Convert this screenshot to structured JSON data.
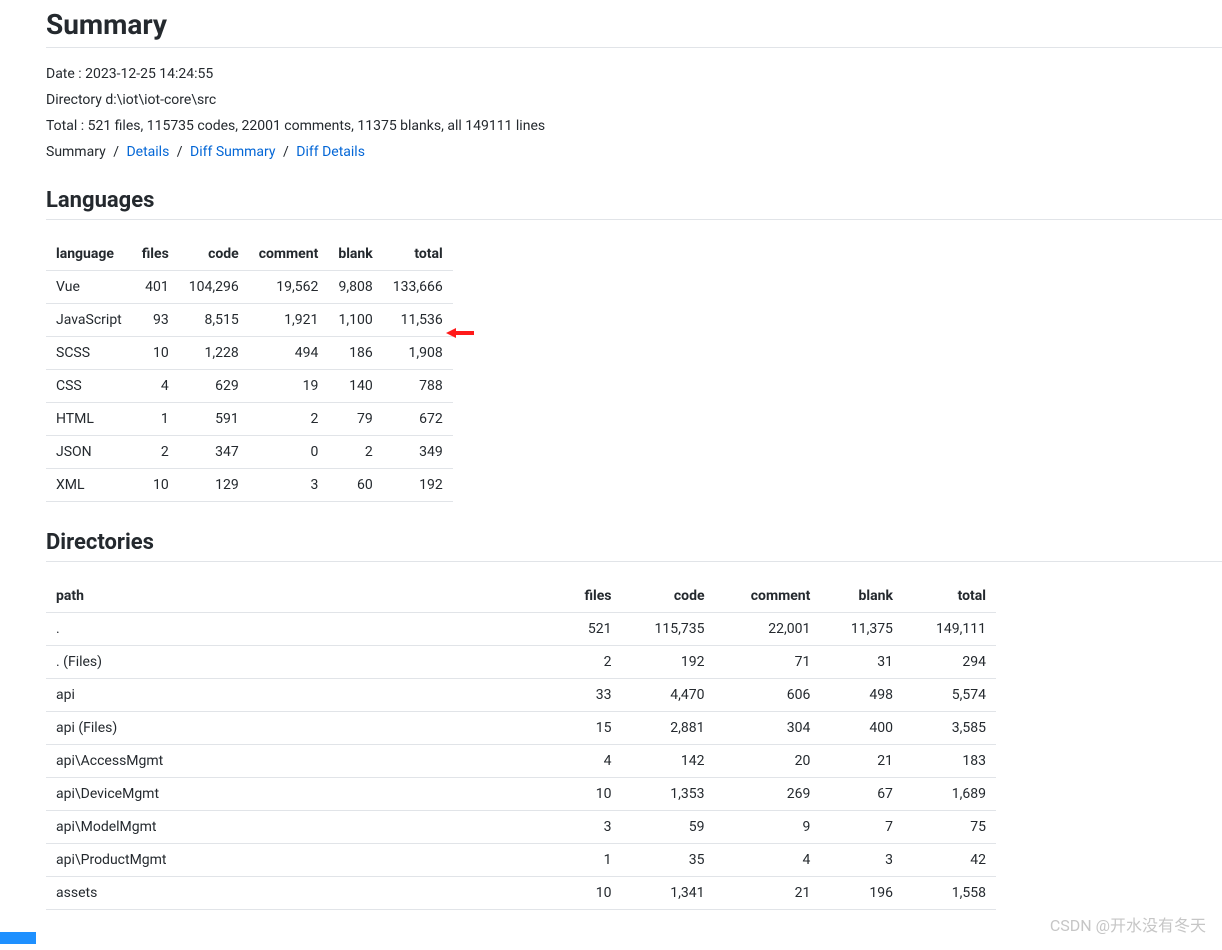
{
  "headings": {
    "summary": "Summary",
    "languages": "Languages",
    "directories": "Directories"
  },
  "meta": {
    "date": "Date : 2023-12-25 14:24:55",
    "directory": "Directory d:\\iot\\iot-core\\src",
    "total": "Total : 521 files, 115735 codes, 22001 comments, 11375 blanks, all 149111 lines"
  },
  "breadcrumb": {
    "current": "Summary",
    "links": [
      {
        "label": "Details"
      },
      {
        "label": "Diff Summary"
      },
      {
        "label": "Diff Details"
      }
    ]
  },
  "columns": {
    "language": "language",
    "path": "path",
    "files": "files",
    "code": "code",
    "comment": "comment",
    "blank": "blank",
    "total": "total"
  },
  "languages": [
    {
      "language": "Vue",
      "files": "401",
      "code": "104,296",
      "comment": "19,562",
      "blank": "9,808",
      "total": "133,666"
    },
    {
      "language": "JavaScript",
      "files": "93",
      "code": "8,515",
      "comment": "1,921",
      "blank": "1,100",
      "total": "11,536"
    },
    {
      "language": "SCSS",
      "files": "10",
      "code": "1,228",
      "comment": "494",
      "blank": "186",
      "total": "1,908"
    },
    {
      "language": "CSS",
      "files": "4",
      "code": "629",
      "comment": "19",
      "blank": "140",
      "total": "788"
    },
    {
      "language": "HTML",
      "files": "1",
      "code": "591",
      "comment": "2",
      "blank": "79",
      "total": "672"
    },
    {
      "language": "JSON",
      "files": "2",
      "code": "347",
      "comment": "0",
      "blank": "2",
      "total": "349"
    },
    {
      "language": "XML",
      "files": "10",
      "code": "129",
      "comment": "3",
      "blank": "60",
      "total": "192"
    }
  ],
  "directories": [
    {
      "path": ".",
      "files": "521",
      "code": "115,735",
      "comment": "22,001",
      "blank": "11,375",
      "total": "149,111"
    },
    {
      "path": ". (Files)",
      "files": "2",
      "code": "192",
      "comment": "71",
      "blank": "31",
      "total": "294"
    },
    {
      "path": "api",
      "files": "33",
      "code": "4,470",
      "comment": "606",
      "blank": "498",
      "total": "5,574"
    },
    {
      "path": "api (Files)",
      "files": "15",
      "code": "2,881",
      "comment": "304",
      "blank": "400",
      "total": "3,585"
    },
    {
      "path": "api\\AccessMgmt",
      "files": "4",
      "code": "142",
      "comment": "20",
      "blank": "21",
      "total": "183"
    },
    {
      "path": "api\\DeviceMgmt",
      "files": "10",
      "code": "1,353",
      "comment": "269",
      "blank": "67",
      "total": "1,689"
    },
    {
      "path": "api\\ModelMgmt",
      "files": "3",
      "code": "59",
      "comment": "9",
      "blank": "7",
      "total": "75"
    },
    {
      "path": "api\\ProductMgmt",
      "files": "1",
      "code": "35",
      "comment": "4",
      "blank": "3",
      "total": "42"
    },
    {
      "path": "assets",
      "files": "10",
      "code": "1,341",
      "comment": "21",
      "blank": "196",
      "total": "1,558"
    }
  ],
  "watermark": "CSDN @开水没有冬天"
}
